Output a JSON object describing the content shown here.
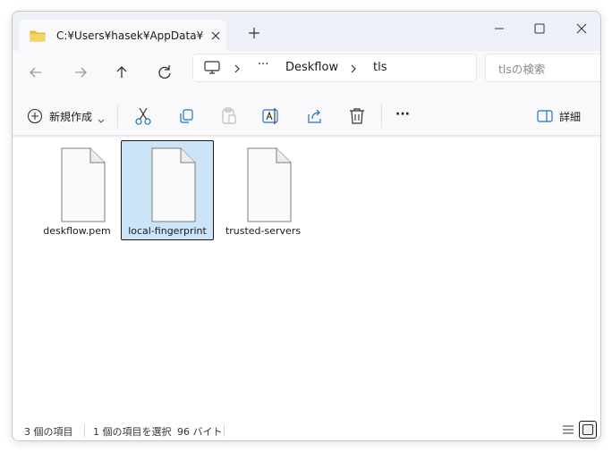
{
  "window": {
    "tab_title": "C:¥Users¥hasek¥AppData¥Loc"
  },
  "navigation": {
    "address": {
      "overflow": "···",
      "segments": [
        "Deskflow",
        "tls"
      ]
    },
    "search": {
      "placeholder": "tlsの検索"
    }
  },
  "toolbar": {
    "new_label": "新規作成",
    "details_label": "詳細",
    "more": "···"
  },
  "files": [
    {
      "name": "deskflow.pem",
      "selected": false
    },
    {
      "name": "local-fingerprint",
      "selected": true
    },
    {
      "name": "trusted-servers",
      "selected": false
    }
  ],
  "status": {
    "item_count": "3 個の項目",
    "selected": "1 個の項目を選択",
    "size": "96 バイト"
  },
  "colors": {
    "accent": "#1a73c8",
    "selection": "#cce4f7",
    "folder": "#f0c33c"
  }
}
